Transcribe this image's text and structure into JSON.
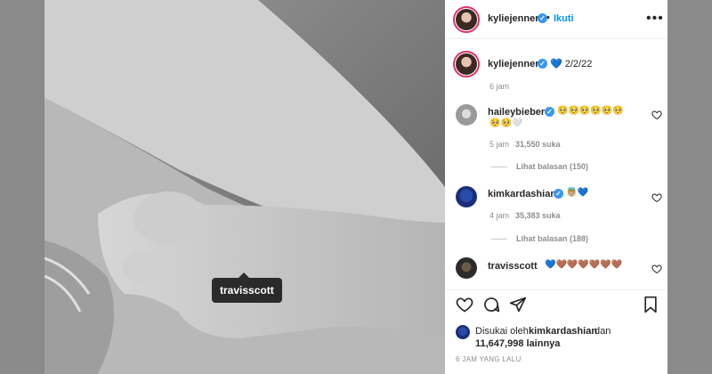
{
  "photo": {
    "tag_label": "travisscott"
  },
  "header": {
    "username": "kyliejenner",
    "separator": "•",
    "follow_label": "Ikuti",
    "more_label": "•••"
  },
  "caption": {
    "username": "kyliejenner",
    "text": "💙 2/2/22",
    "time": "6 jam"
  },
  "comments": [
    {
      "username": "haileybieber",
      "text_line1": "🥺🥺🥺🥺🥺🥺",
      "text_line2": "🥺🥺🤍",
      "time": "5 jam",
      "likes": "31,550 suka",
      "replies": "Lihat balasan (150)"
    },
    {
      "username": "kimkardashian",
      "text_line1": "👼🏼💙",
      "time": "4 jam",
      "likes": "35,383 suka",
      "replies": "Lihat balasan (188)"
    },
    {
      "username": "travisscott",
      "text_line1": "💙🤎🤎🤎🤎🤎🤎"
    }
  ],
  "likes_summary": {
    "prefix": "Disukai oleh",
    "user": "kimkardashian",
    "mid": "dan",
    "count": "11,647,998 lainnya"
  },
  "timestamp": "6 JAM YANG LALU",
  "colors": {
    "accent": "#0095f6",
    "verified": "#3897f0"
  }
}
